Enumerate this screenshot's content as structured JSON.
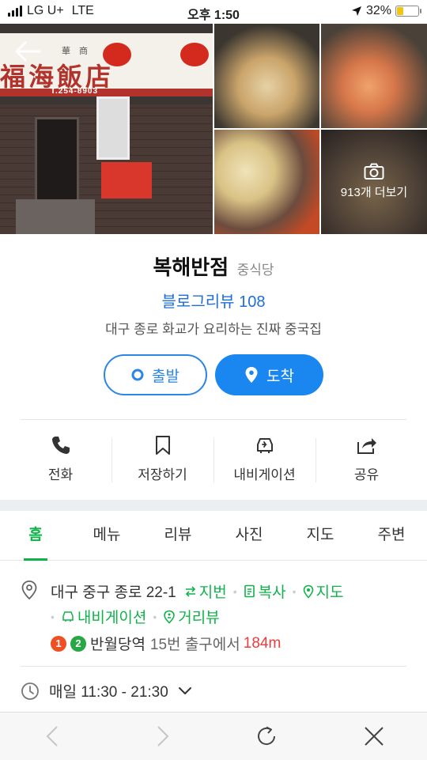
{
  "status_bar": {
    "carrier": "LG U+",
    "network": "LTE",
    "time": "오후 1:50",
    "battery": "32%",
    "battery_level": 0.32
  },
  "photos": {
    "sign_top": "華 商",
    "sign_name": "福海飯店",
    "sign_phone": "T.254-8903",
    "more_label": "913개 더보기"
  },
  "place": {
    "name": "복해반점",
    "category": "중식당",
    "blog_review": "블로그리뷰 108",
    "description": "대구 종로 화교가 요리하는 진짜 중국집"
  },
  "buttons": {
    "start": "출발",
    "arrive": "도착"
  },
  "actions": [
    {
      "label": "전화",
      "icon": "phone-icon"
    },
    {
      "label": "저장하기",
      "icon": "bookmark-icon"
    },
    {
      "label": "내비게이션",
      "icon": "car-icon"
    },
    {
      "label": "공유",
      "icon": "share-icon"
    }
  ],
  "tabs": [
    "홈",
    "메뉴",
    "리뷰",
    "사진",
    "지도",
    "주변"
  ],
  "active_tab": "홈",
  "address": {
    "text": "대구 중구 종로 22-1",
    "links": [
      "지번",
      "복사",
      "지도",
      "내비게이션",
      "거리뷰"
    ]
  },
  "subway": {
    "lines": [
      "1",
      "2"
    ],
    "station": "반월당역",
    "exit": "15번 출구에서",
    "distance": "184m"
  },
  "hours": "매일 11:30 - 21:30",
  "colors": {
    "accent_green": "#0fb34a",
    "accent_blue": "#1a86f0",
    "distance_red": "#ef3b3b"
  }
}
